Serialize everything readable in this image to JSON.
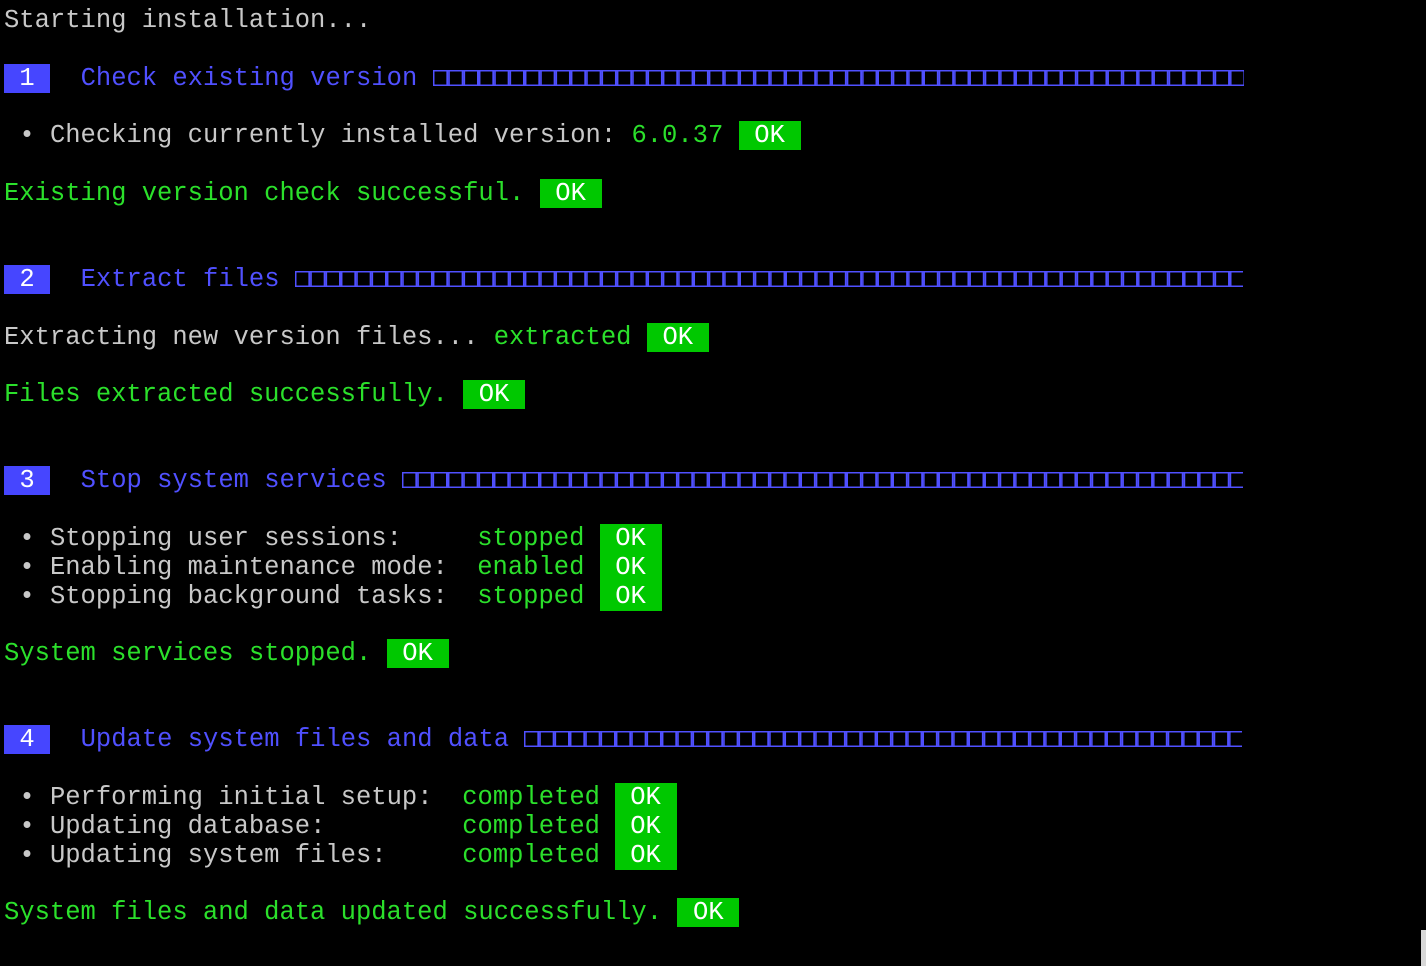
{
  "header": "Starting installation...",
  "sections": [
    {
      "number": "1",
      "title": "Check existing version",
      "items": [
        {
          "bullet": "•",
          "label": "Checking currently installed version:",
          "value": "6.0.37",
          "status": "OK"
        }
      ],
      "summary": {
        "text": "Existing version check successful.",
        "status": "OK"
      }
    },
    {
      "number": "2",
      "title": "Extract files",
      "plain": {
        "label": "Extracting new version files...",
        "value": "extracted",
        "status": "OK"
      },
      "summary": {
        "text": "Files extracted successfully.",
        "status": "OK"
      }
    },
    {
      "number": "3",
      "title": "Stop system services",
      "items": [
        {
          "bullet": "•",
          "label": "Stopping user sessions:",
          "value": "stopped",
          "status": "OK"
        },
        {
          "bullet": "•",
          "label": "Enabling maintenance mode:",
          "value": "enabled",
          "status": "OK"
        },
        {
          "bullet": "•",
          "label": "Stopping background tasks:",
          "value": "stopped",
          "status": "OK"
        }
      ],
      "summary": {
        "text": "System services stopped.",
        "status": "OK"
      }
    },
    {
      "number": "4",
      "title": "Update system files and data",
      "items": [
        {
          "bullet": "•",
          "label": "Performing initial setup:",
          "value": "completed",
          "status": "OK"
        },
        {
          "bullet": "•",
          "label": "Updating database:",
          "value": "completed",
          "status": "OK"
        },
        {
          "bullet": "•",
          "label": "Updating system files:",
          "value": "completed",
          "status": "OK"
        }
      ],
      "summary": {
        "text": "System files and data updated successfully.",
        "status": "OK"
      }
    }
  ],
  "colors": {
    "background": "#000000",
    "text": "#c8c8c8",
    "heading": "#5050ff",
    "success": "#2be02b",
    "ok_badge": "#00c800"
  }
}
